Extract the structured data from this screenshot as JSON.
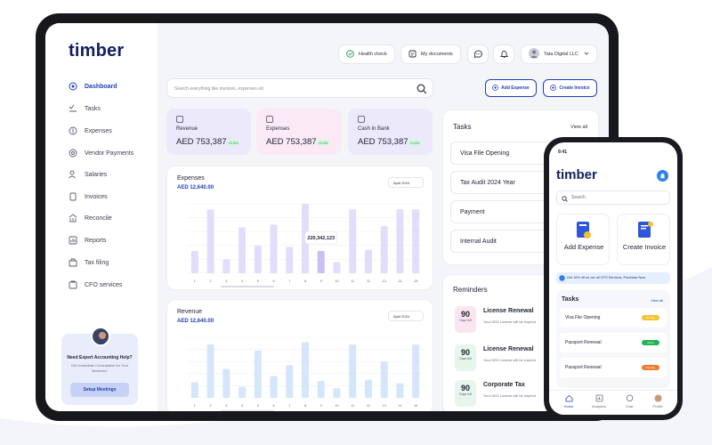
{
  "app": {
    "logo": "timber"
  },
  "sidebar": {
    "items": [
      {
        "label": "Dashboard",
        "icon": "dashboard-icon",
        "active": true
      },
      {
        "label": "Tasks",
        "icon": "tasks-icon"
      },
      {
        "label": "Expenses",
        "icon": "expenses-icon"
      },
      {
        "label": "Vendor Payments",
        "icon": "vendor-payments-icon"
      },
      {
        "label": "Salaries",
        "icon": "salaries-icon"
      },
      {
        "label": "Invoices",
        "icon": "invoices-icon"
      },
      {
        "label": "Reconcile",
        "icon": "reconcile-icon"
      },
      {
        "label": "Reports",
        "icon": "reports-icon"
      },
      {
        "label": "Tax filing",
        "icon": "tax-filing-icon"
      },
      {
        "label": "CFO services",
        "icon": "cfo-services-icon"
      }
    ],
    "promo": {
      "title": "Need Expert Accounting Help?",
      "text": "Get Immediate Consultation for Your Business!",
      "button": "Setup Meetings"
    }
  },
  "header": {
    "health_check": "Health check",
    "my_documents": "My documents",
    "company": "Tata Digital LLC"
  },
  "search": {
    "placeholder": "Search everything like invoices, expenses etc"
  },
  "actions": {
    "add_expense": "Add Expense",
    "create_invoice": "Create Invoice"
  },
  "stats": [
    {
      "label": "Revenue",
      "value": "AED  753,387",
      "change": "+3.4%",
      "color": "#ece9fb"
    },
    {
      "label": "Expenses",
      "value": "AED  753,387",
      "change": "+3.4%",
      "color": "#fbe9f6"
    },
    {
      "label": "Cash in Bank",
      "value": "AED  753,387",
      "change": "+3.4%",
      "color": "#ece9fb"
    }
  ],
  "chart_data": [
    {
      "type": "bar",
      "title": "Expenses",
      "subtitle": "AED 12,640.00",
      "period": "April 2024",
      "categories": [
        "1",
        "2",
        "3",
        "4",
        "5",
        "6",
        "7",
        "8",
        "9",
        "10",
        "11",
        "12",
        "13",
        "14",
        "15"
      ],
      "values": [
        16,
        46,
        10,
        33,
        20,
        35,
        19,
        50,
        16,
        8,
        46,
        17,
        34,
        46,
        46
      ],
      "highlight_index": 8,
      "tooltip": "220,342,123",
      "ylim": [
        0,
        50
      ],
      "ytick_labels": [
        "",
        "",
        "",
        "",
        "",
        ""
      ],
      "colors": {
        "bar": "#e4dcfb",
        "highlight": "#cbbdf6"
      }
    },
    {
      "type": "bar",
      "title": "Revenue",
      "subtitle": "AED 12,640.00",
      "period": "April 2024",
      "categories": [
        "1",
        "2",
        "3",
        "4",
        "5",
        "6",
        "7",
        "8",
        "9",
        "10",
        "11",
        "12",
        "13",
        "14",
        "15"
      ],
      "values": [
        13,
        44,
        24,
        9,
        39,
        18,
        27,
        46,
        14,
        8,
        44,
        15,
        30,
        12,
        44
      ],
      "ylim": [
        0,
        50
      ],
      "ytick_labels": [
        "",
        "",
        "",
        "",
        "",
        ""
      ],
      "colors": {
        "bar": "#d5e6fb"
      }
    }
  ],
  "tasks": {
    "title": "Tasks",
    "view_all": "View all",
    "items": [
      "Visa File Opening",
      "Tax Audit 2024 Year",
      "Payment",
      "Internal Audit"
    ]
  },
  "reminders": {
    "title": "Reminders",
    "items": [
      {
        "days": "90",
        "days_label": "Days left",
        "title": "License Renewal",
        "text": "Your DED License will be expired",
        "color": "#fbe6f0"
      },
      {
        "days": "90",
        "days_label": "Days left",
        "title": "License Renewal",
        "text": "Your DED License will be expired",
        "color": "#e6f6ec"
      },
      {
        "days": "90",
        "days_label": "Days left",
        "title": "Corporate Tax",
        "text": "Your DED License will be expired",
        "color": "#e6f6ec"
      }
    ]
  },
  "phone": {
    "time": "9:41",
    "logo": "timber",
    "search_placeholder": "Search",
    "add_expense": "Add Expense",
    "create_invoice": "Create Invoice",
    "banner": "Get 10% off on our all CFO Services, Purchase Now",
    "tasks_title": "Tasks",
    "view_all": "View all",
    "tasks": [
      {
        "label": "Visa File Opening",
        "status": "Pending",
        "color": "#f2c230"
      },
      {
        "label": "Passport Renewal",
        "status": "Done",
        "color": "#22b45a"
      },
      {
        "label": "Passport Renewal",
        "status": "Pending",
        "color": "#f07a30"
      }
    ],
    "nav": [
      "Home",
      "Analytics",
      "Chat",
      "Profile"
    ]
  }
}
